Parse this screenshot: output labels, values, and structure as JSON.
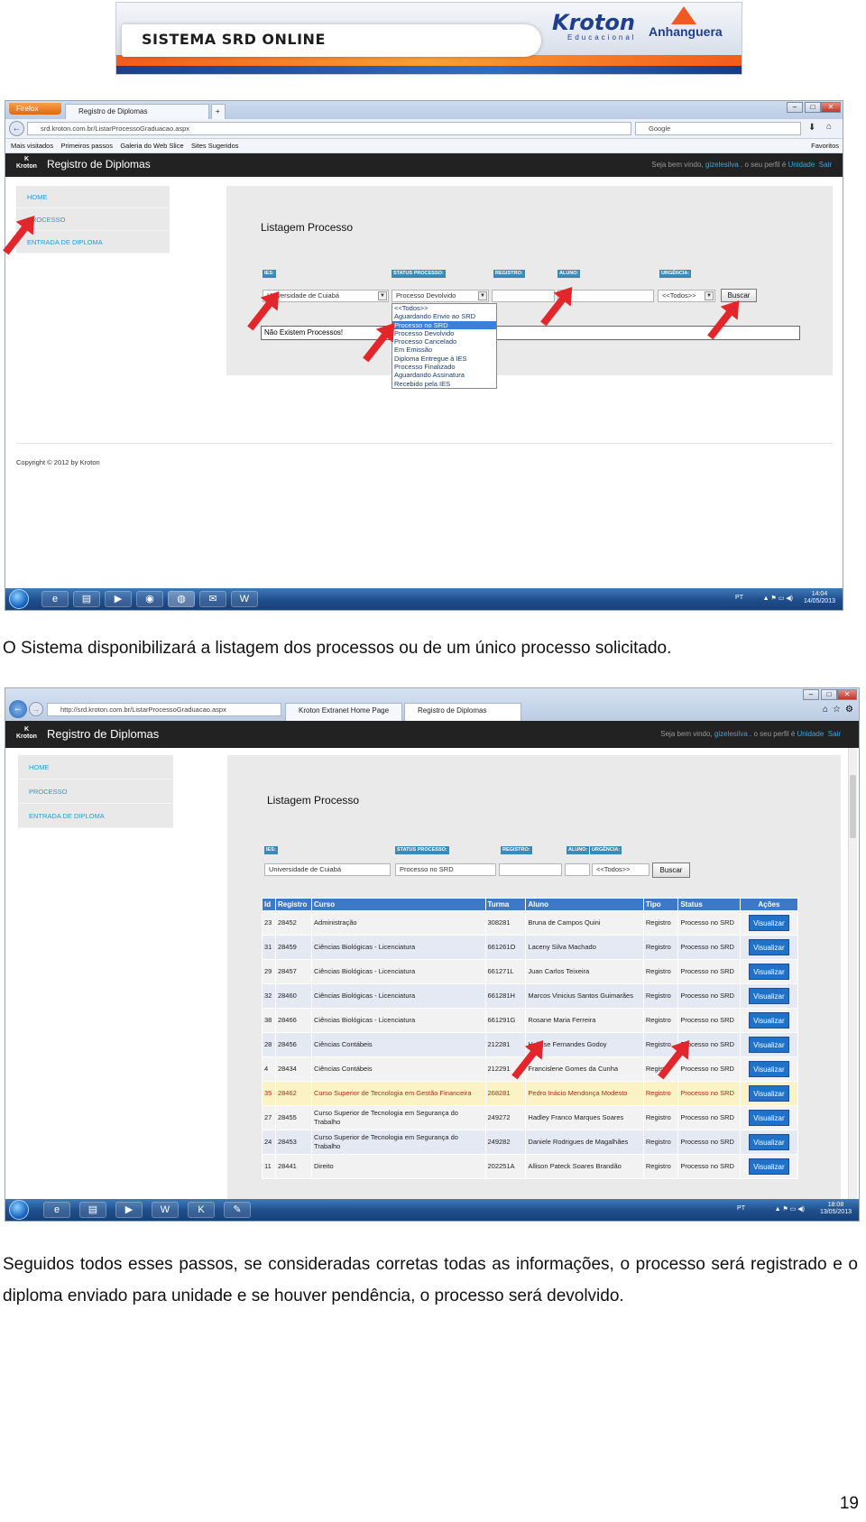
{
  "banner": {
    "title": "SISTEMA SRD ONLINE",
    "kroton": "Kroton",
    "kroton_sub": "Educacional",
    "anhanguera": "Anhanguera"
  },
  "shot1": {
    "firefox_btn": "Firefox",
    "tab_label": "Registro de Diplomas",
    "url": "srd.kroton.com.br/ListarProcessoGraduacao.aspx",
    "search_placeholder": "Google",
    "bookmarks": [
      "Mais visitados",
      "Primeiros passos",
      "Galeria do Web Slice",
      "Sites Sugeridos"
    ],
    "favorites": "Favoritos",
    "app_title": "Registro de Diplomas",
    "welcome": "Seja bem vindo,",
    "welcome_user": "gizelesilva",
    "welcome_profile": ". o seu perfil é",
    "welcome_unit": "Unidade",
    "welcome_exit": "Sair",
    "menu": [
      "HOME",
      "PROCESSO",
      "ENTRADA DE DIPLOMA"
    ],
    "page_heading": "Listagem Processo",
    "labels": {
      "ies": "IES:",
      "status": "STATUS PROCESSO:",
      "registro": "REGISTRO:",
      "aluno": "ALUNO:",
      "urgencia": "URGÊNCIA:"
    },
    "ies_value": "Universidade de Cuiabá",
    "status_value": "Processo Devolvido",
    "urgencia_value": "<<Todos>>",
    "buscar": "Buscar",
    "no_results": "Não Existem Processos!",
    "dropdown_options": [
      "<<Todos>>",
      "Aguardando Envio ao SRD",
      "Processo no SRD",
      "Processo Devolvido",
      "Processo Cancelado",
      "Em Emissão",
      "Diploma Entregue à IES",
      "Processo Finalizado",
      "Aguardando Assinatura",
      "Recebido pela IES"
    ],
    "dropdown_selected": "Processo no SRD",
    "copyright": "Copyright © 2012 by Kroton",
    "lang": "PT",
    "time": "14:04",
    "date": "14/05/2013"
  },
  "para1": "O Sistema disponibilizará a listagem dos processos ou de um único processo solicitado.",
  "shot2": {
    "url": "http://srd.kroton.com.br/ListarProcessoGraduacao.aspx",
    "tabs": [
      "Kroton Extranet Home Page",
      "Registro de Diplomas"
    ],
    "app_title": "Registro de Diplomas",
    "welcome": "Seja bem vindo,",
    "welcome_user": "gizelesilva",
    "welcome_profile": ". o seu perfil é",
    "welcome_unit": "Unidade",
    "welcome_exit": "Sair",
    "menu": [
      "HOME",
      "PROCESSO",
      "ENTRADA DE DIPLOMA"
    ],
    "page_heading": "Listagem Processo",
    "labels": {
      "ies": "IES:",
      "status": "STATUS PROCESSO:",
      "registro": "REGISTRO:",
      "aluno": "ALUNO:",
      "urgencia": "URGÊNCIA:"
    },
    "ies_value": "Universidade de Cuiabá",
    "status_value": "Processo no SRD",
    "urgencia_value": "<<Todos>>",
    "buscar": "Buscar",
    "columns": [
      "Id",
      "Registro",
      "Curso",
      "Turma",
      "Aluno",
      "Tipo",
      "Status",
      "Ações"
    ],
    "rows": [
      {
        "id": "23",
        "registro": "28452",
        "curso": "Administração",
        "turma": "308281",
        "aluno": "Bruna de Campos Quini",
        "tipo": "Registro",
        "status": "Processo no SRD",
        "acao": "Visualizar"
      },
      {
        "id": "31",
        "registro": "28459",
        "curso": "Ciências Biológicas - Licenciatura",
        "turma": "661261O",
        "aluno": "Laceny Silva Machado",
        "tipo": "Registro",
        "status": "Processo no SRD",
        "acao": "Visualizar"
      },
      {
        "id": "29",
        "registro": "28457",
        "curso": "Ciências Biológicas - Licenciatura",
        "turma": "661271L",
        "aluno": "Juan Carlos Teixeira",
        "tipo": "Registro",
        "status": "Processo no SRD",
        "acao": "Visualizar"
      },
      {
        "id": "32",
        "registro": "28460",
        "curso": "Ciências Biológicas - Licenciatura",
        "turma": "661281H",
        "aluno": "Marcos Vinicius Santos Guimarães",
        "tipo": "Registro",
        "status": "Processo no SRD",
        "acao": "Visualizar"
      },
      {
        "id": "38",
        "registro": "28466",
        "curso": "Ciências Biológicas - Licenciatura",
        "turma": "661291G",
        "aluno": "Rosane Maria Ferreira",
        "tipo": "Registro",
        "status": "Processo no SRD",
        "acao": "Visualizar"
      },
      {
        "id": "28",
        "registro": "28456",
        "curso": "Ciências Contábeis",
        "turma": "212281",
        "aluno": "Heloise Fernandes Godoy",
        "tipo": "Registro",
        "status": "Processo no SRD",
        "acao": "Visualizar"
      },
      {
        "id": "4",
        "registro": "28434",
        "curso": "Ciências Contábeis",
        "turma": "212291",
        "aluno": "Francislene Gomes da Cunha",
        "tipo": "Registro",
        "status": "Processo no SRD",
        "acao": "Visualizar"
      },
      {
        "id": "35",
        "registro": "28462",
        "curso": "Curso Superior de Tecnologia em Gestão Financeira",
        "turma": "268281",
        "aluno": "Pedro Inácio Mendonça Modesto",
        "tipo": "Registro",
        "status": "Processo no SRD",
        "acao": "Visualizar"
      },
      {
        "id": "27",
        "registro": "28455",
        "curso": "Curso Superior de Tecnologia em Segurança do Trabalho",
        "turma": "249272",
        "aluno": "Hadley Franco Marques Soares",
        "tipo": "Registro",
        "status": "Processo no SRD",
        "acao": "Visualizar"
      },
      {
        "id": "24",
        "registro": "28453",
        "curso": "Curso Superior de Tecnologia em Segurança do Trabalho",
        "turma": "249282",
        "aluno": "Daniele Rodrigues de Magalhães",
        "tipo": "Registro",
        "status": "Processo no SRD",
        "acao": "Visualizar"
      },
      {
        "id": "11",
        "registro": "28441",
        "curso": "Direito",
        "turma": "202251A",
        "aluno": "Allison Pateck Soares Brandão",
        "tipo": "Registro",
        "status": "Processo no SRD",
        "acao": "Visualizar"
      }
    ],
    "lang": "PT",
    "time": "18:08",
    "date": "13/05/2013"
  },
  "para2": "Seguidos todos esses passos, se consideradas corretas todas as informações, o processo será registrado e o diploma enviado para unidade e se houver pendência, o processo será devolvido.",
  "page_number": "19"
}
